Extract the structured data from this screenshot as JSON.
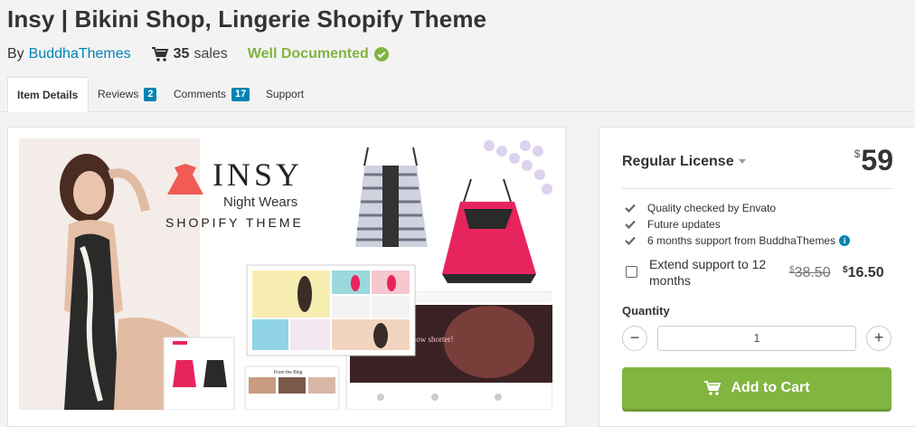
{
  "title": "Insy | Bikini Shop, Lingerie Shopify Theme",
  "meta": {
    "by": "By",
    "author": "BuddhaThemes",
    "sales_count": "35",
    "sales_label": "sales",
    "documented": "Well Documented"
  },
  "tabs": [
    {
      "label": "Item Details",
      "active": true
    },
    {
      "label": "Reviews",
      "badge": "2"
    },
    {
      "label": "Comments",
      "badge": "17"
    },
    {
      "label": "Support"
    }
  ],
  "preview": {
    "brand": "INSY",
    "tagline": "Night Wears",
    "subtitle": "SHOPIFY THEME",
    "banner_text": "Sweet Dreams is now shorter!",
    "blog_label": "From the Blog"
  },
  "license": {
    "name": "Regular License",
    "currency": "$",
    "price": "59",
    "features": [
      "Quality checked by Envato",
      "Future updates",
      "6 months support from BuddhaThemes"
    ],
    "extend_label": "Extend support to 12 months",
    "extend_old_price": "38.50",
    "extend_new_price": "16.50",
    "quantity_label": "Quantity",
    "quantity_value": "1",
    "minus": "−",
    "plus": "+",
    "add_to_cart": "Add to Cart"
  },
  "colors": {
    "accent": "#82b440",
    "link": "#0084b4",
    "pink": "#e8245e"
  }
}
